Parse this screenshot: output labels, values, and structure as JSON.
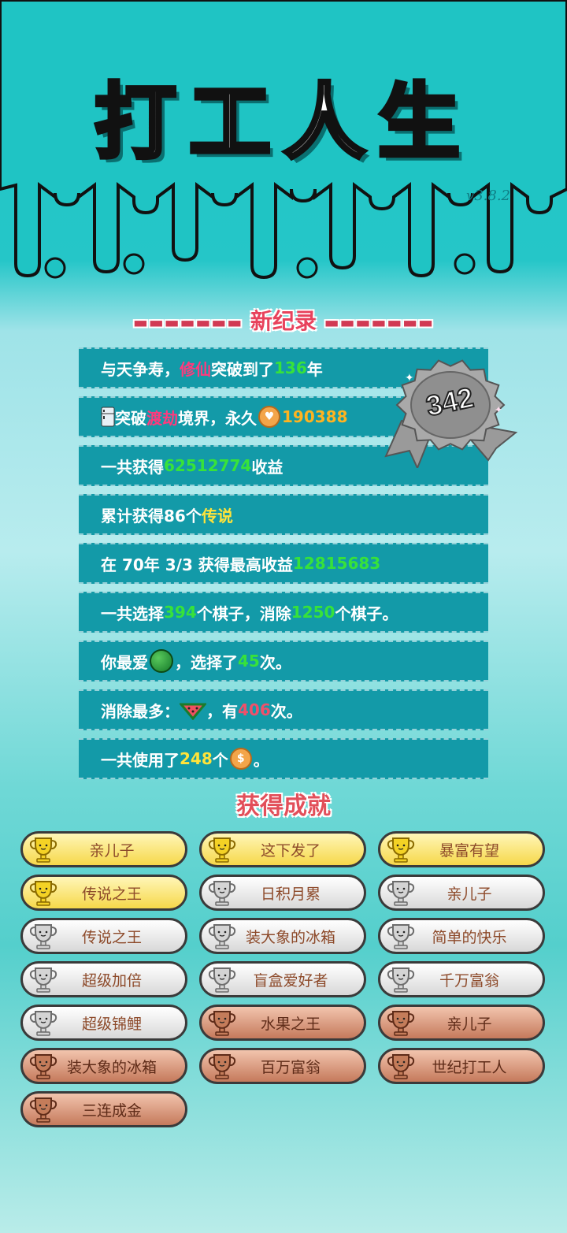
{
  "game": {
    "title": "打工人生",
    "version": "v3.8.2"
  },
  "record": {
    "header": "新纪录",
    "badge_number": "342",
    "rows": [
      {
        "parts": [
          "与天争寿，",
          "修仙",
          "突破到了",
          "136",
          "年"
        ]
      },
      {
        "parts": [
          "突破",
          "渡劫",
          "境界，永久",
          "190388"
        ]
      },
      {
        "parts": [
          "一共获得",
          "62512774",
          "收益"
        ]
      },
      {
        "parts": [
          "累计获得86个",
          "传说"
        ]
      },
      {
        "parts": [
          "在 70年 3/3 获得最高收益",
          "12815683"
        ]
      },
      {
        "parts": [
          "一共选择",
          "394",
          "个棋子，消除",
          "1250",
          "个棋子。"
        ]
      },
      {
        "parts": [
          "你最爱",
          "，选择了",
          "45",
          "次。"
        ]
      },
      {
        "parts": [
          "消除最多：",
          "，有",
          "406",
          "次。"
        ]
      },
      {
        "parts": [
          "一共使用了",
          "248",
          "个",
          "。"
        ]
      }
    ]
  },
  "achievements": {
    "header": "获得成就",
    "items": [
      {
        "label": "亲儿子",
        "tier": "gold"
      },
      {
        "label": "这下发了",
        "tier": "gold"
      },
      {
        "label": "暴富有望",
        "tier": "gold"
      },
      {
        "label": "传说之王",
        "tier": "gold"
      },
      {
        "label": "日积月累",
        "tier": "silver"
      },
      {
        "label": "亲儿子",
        "tier": "silver"
      },
      {
        "label": "传说之王",
        "tier": "silver"
      },
      {
        "label": "装大象的冰箱",
        "tier": "silver"
      },
      {
        "label": "简单的快乐",
        "tier": "silver"
      },
      {
        "label": "超级加倍",
        "tier": "silver"
      },
      {
        "label": "盲盒爱好者",
        "tier": "silver"
      },
      {
        "label": "千万富翁",
        "tier": "silver"
      },
      {
        "label": "超级锦鲤",
        "tier": "silver"
      },
      {
        "label": "水果之王",
        "tier": "bronze"
      },
      {
        "label": "亲儿子",
        "tier": "bronze"
      },
      {
        "label": "装大象的冰箱",
        "tier": "bronze"
      },
      {
        "label": "百万富翁",
        "tier": "bronze"
      },
      {
        "label": "世纪打工人",
        "tier": "bronze"
      },
      {
        "label": "三连成金",
        "tier": "bronze"
      }
    ]
  },
  "colors": {
    "teal": "#1fc4c4",
    "row_bg": "#139aa8",
    "highlight_green": "#37e23a",
    "highlight_yellow": "#ffe33a",
    "highlight_red": "#f0506a",
    "header_red": "#e24f5a"
  },
  "icons": {
    "coin": "coin-icon",
    "heart_coin": "heart-coin-icon",
    "watermelon": "watermelon-icon",
    "watermelon_slice": "watermelon-slice-icon",
    "fridge": "fridge-icon",
    "trophy": "trophy-icon",
    "ribbon_badge": "ribbon-badge-icon"
  }
}
